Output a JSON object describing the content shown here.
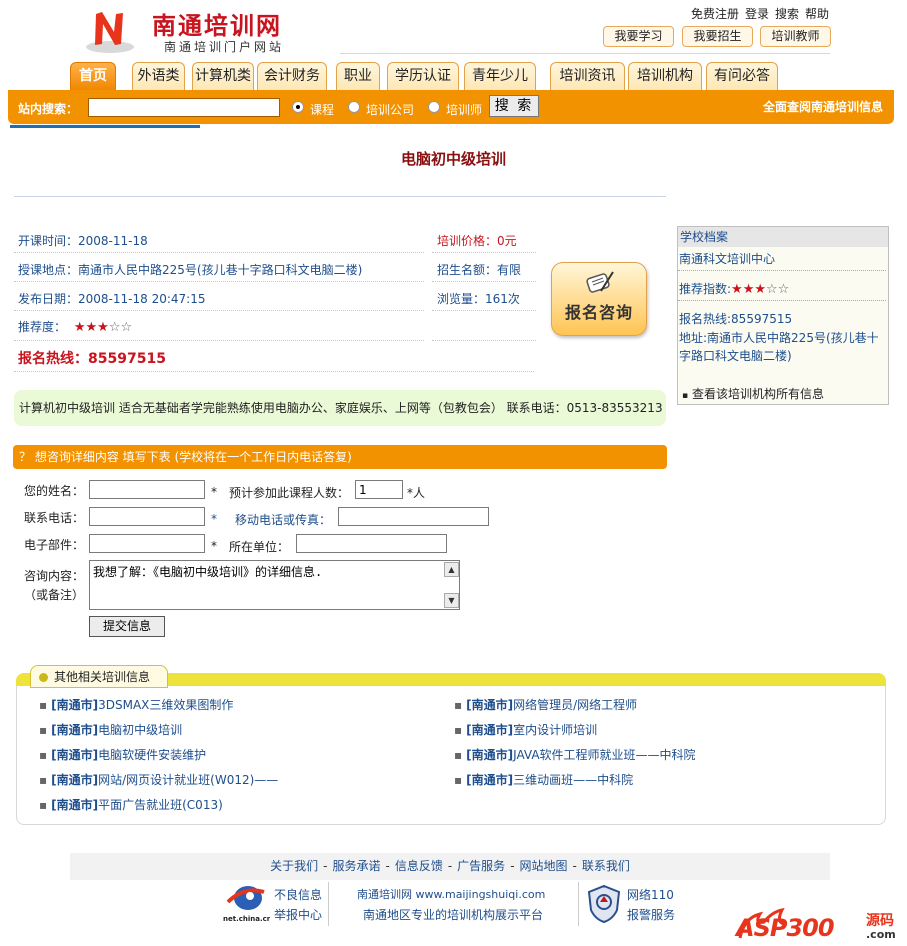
{
  "header": {
    "logo_letter": "N",
    "logo_title": "南通培训网",
    "logo_subtitle": "南通培训门户网站",
    "top_links": [
      "免费注册",
      "登录",
      "搜索",
      "帮助"
    ],
    "top_buttons": [
      "我要学习",
      "我要招生",
      "培训教师"
    ]
  },
  "nav": {
    "tabs": [
      "首页",
      "外语类",
      "计算机类",
      "会计财务",
      "职业",
      "学历认证",
      "青年少儿",
      "培训资讯",
      "培训机构",
      "有问必答"
    ]
  },
  "search": {
    "label": "站内搜索：",
    "value": "",
    "options": [
      "课程",
      "培训公司",
      "培训师"
    ],
    "button": "搜 索",
    "all_link": "全面查阅南通培训信息"
  },
  "course": {
    "title": "电脑初中级培训",
    "start_label": "开课时间：",
    "start_value": "2008-11-18",
    "location_label": "授课地点：",
    "location_value": "南通市人民中路225号(孩儿巷十字路口科文电脑二楼)",
    "publish_label": "发布日期：",
    "publish_value": "2008-11-18 20:47:15",
    "rating_label": "推荐度：",
    "rating_value": 3,
    "rating_max": 5,
    "price_label": "培训价格：",
    "price_value": "0元",
    "quota_label": "招生名额：",
    "quota_value": "有限",
    "views_label": "浏览量：",
    "views_value": "161次",
    "hotline_label": "报名热线：",
    "hotline_value": "85597515",
    "consult_button": "报名咨询",
    "description": "计算机初中级培训 适合无基础者学完能熟练使用电脑办公、家庭娱乐、上网等（包教包会） 联系电话：0513-83553213"
  },
  "school": {
    "header": "学校档案",
    "name": "南通科文培训中心",
    "rating_label": "推荐指数:",
    "rating_value": 3,
    "rating_max": 5,
    "hotline": "报名热线:85597515",
    "address_1": "地址:南通市人民中路225号(孩儿巷十",
    "address_2": "字路口科文电脑二楼)",
    "more_link": "查看该培训机构所有信息"
  },
  "form": {
    "header": "？ 想咨询详细内容 填写下表 (学校将在一个工作日内电话答复)",
    "name_label": "您的姓名：",
    "name_value": "",
    "count_label": "预计参加此课程人数：",
    "count_value": "1",
    "count_unit": "人",
    "phone_label": "联系电话：",
    "phone_value": "",
    "mobile_label": "移动电话或传真：",
    "mobile_value": "",
    "email_label": "电子部件：",
    "email_value": "",
    "org_label": "所在单位：",
    "org_value": "",
    "content_label": "咨询内容：",
    "content_note": "（或备注）",
    "content_value": "我想了解：《电脑初中级培训》的详细信息.",
    "required_mark": "*",
    "submit": "提交信息"
  },
  "related": {
    "tab_label": "其他相关培训信息",
    "items_left": [
      {
        "city": "[南通市]",
        "title": "3DSMAX三维效果图制作"
      },
      {
        "city": "[南通市]",
        "title": "电脑初中级培训"
      },
      {
        "city": "[南通市]",
        "title": "电脑软硬件安装维护"
      },
      {
        "city": "[南通市]",
        "title": "网站/网页设计就业班(W012)——"
      },
      {
        "city": "[南通市]",
        "title": "平面广告就业班(C013)"
      }
    ],
    "items_right": [
      {
        "city": "[南通市]",
        "title": "网络管理员/网络工程师"
      },
      {
        "city": "[南通市]",
        "title": "室内设计师培训"
      },
      {
        "city": "[南通市]",
        "title": "JAVA软件工程师就业班——中科院"
      },
      {
        "city": "[南通市]",
        "title": "三维动画班——中科院"
      }
    ]
  },
  "footer": {
    "links": [
      "关于我们",
      "服务承诺",
      "信息反馈",
      "广告服务",
      "网站地图",
      "联系我们"
    ],
    "badge_left_text": "net.china.cn",
    "report_1": "不良信息",
    "report_2": "举报中心",
    "site_line_1": "南通培训网 www.maijingshuiqi.com",
    "site_line_2": "南通地区专业的培训机构展示平台",
    "police_1": "网络110",
    "police_2": "报警服务",
    "watermark_main": "ASP300",
    "watermark_sub": "源码",
    "watermark_dom": ".com"
  },
  "colors": {
    "orange": "#f39200",
    "link_blue": "#1e4e8c",
    "red": "#c8141e",
    "title_dark_red": "#8a1010"
  }
}
